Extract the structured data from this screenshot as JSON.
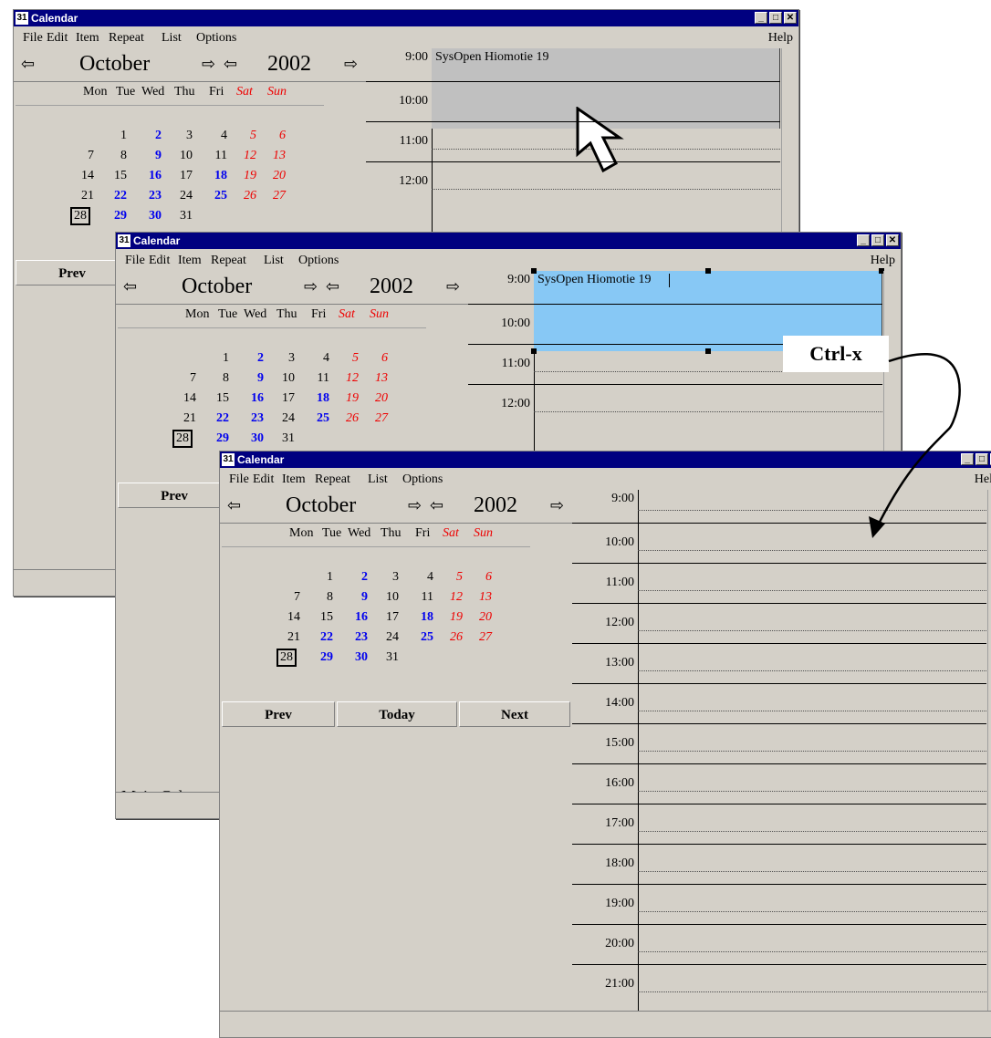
{
  "windows": [
    {
      "id": "w1",
      "title": "Calendar",
      "menu": [
        "File",
        "Edit",
        "Item",
        "Repeat",
        "List",
        "Options"
      ],
      "help": "Help",
      "month": "October",
      "year": "2002",
      "times": [
        "9:00",
        "10:00",
        "11:00",
        "12:00"
      ],
      "event": "SysOpen Hiomotie 19",
      "prev": "Prev"
    },
    {
      "id": "w2",
      "title": "Calendar",
      "menu": [
        "File",
        "Edit",
        "Item",
        "Repeat",
        "List",
        "Options"
      ],
      "help": "Help",
      "month": "October",
      "year": "2002",
      "times": [
        "9:00",
        "10:00",
        "11:00",
        "12:00"
      ],
      "event": "SysOpen Hiomotie 19",
      "prev": "Prev",
      "footer": "Main Calenc"
    },
    {
      "id": "w3",
      "title": "Calendar",
      "menu": [
        "File",
        "Edit",
        "Item",
        "Repeat",
        "List",
        "Options"
      ],
      "help": "Help",
      "month": "October",
      "year": "2002",
      "times": [
        "9:00",
        "10:00",
        "11:00",
        "12:00",
        "13:00",
        "14:00",
        "15:00",
        "16:00",
        "17:00",
        "18:00",
        "19:00",
        "20:00",
        "21:00"
      ],
      "prev": "Prev",
      "today": "Today",
      "next": "Next"
    }
  ],
  "weekdays": [
    "Mon",
    "Tue",
    "Wed",
    "Thu",
    "Fri",
    "Sat",
    "Sun"
  ],
  "weeks": [
    [
      "",
      "1",
      "2",
      "3",
      "4",
      "5",
      "6"
    ],
    [
      "7",
      "8",
      "9",
      "10",
      "11",
      "12",
      "13"
    ],
    [
      "14",
      "15",
      "16",
      "17",
      "18",
      "19",
      "20"
    ],
    [
      "21",
      "22",
      "23",
      "24",
      "25",
      "26",
      "27"
    ],
    [
      "28",
      "29",
      "30",
      "31",
      "",
      "",
      ""
    ]
  ],
  "days_with_items": [
    "2",
    "9",
    "16",
    "18",
    "22",
    "23",
    "25",
    "29",
    "30"
  ],
  "today_day": "28",
  "annotation": "Ctrl-x",
  "colors": {
    "titlebar": "#000080",
    "selected_item": "#87c8f5",
    "event_grey": "#c0c0c0",
    "weekend": "#ee0000",
    "item_day": "#0000ee"
  }
}
